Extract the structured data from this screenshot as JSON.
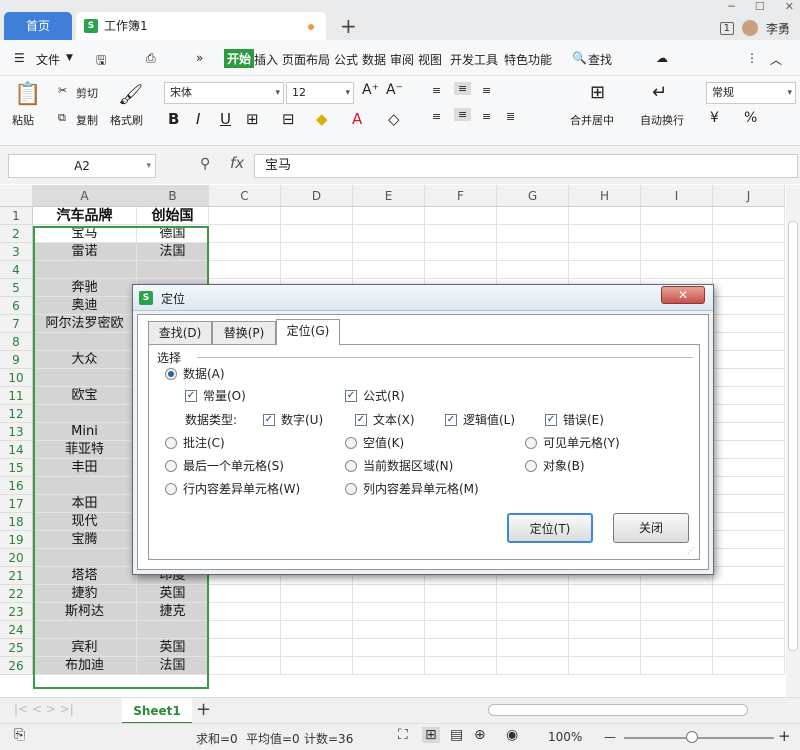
{
  "titlebar": {
    "home_tab": "首页",
    "workbook_tab": "工作簿1",
    "new_tab": "+",
    "badge": "1",
    "user": "李勇",
    "book_icon": "S"
  },
  "menu": {
    "file": "文件",
    "items": [
      "开始",
      "插入",
      "页面布局",
      "公式",
      "数据",
      "审阅",
      "视图",
      "开发工具",
      "特色功能"
    ],
    "search": "查找"
  },
  "ribbon": {
    "paste": "粘贴",
    "cut": "剪切",
    "copy": "复制",
    "format_painter": "格式刷",
    "font": "宋体",
    "size": "12",
    "merge": "合并居中",
    "autowrap": "自动换行",
    "number_format": "常规",
    "percent": "%",
    "bold": "B",
    "italic": "I",
    "underline": "U"
  },
  "formula": {
    "namebox": "A2",
    "fx": "fx",
    "value": "宝马"
  },
  "grid": {
    "columns": [
      "A",
      "B",
      "C",
      "D",
      "E",
      "F",
      "G",
      "H",
      "I",
      "J"
    ],
    "rows": [
      "1",
      "2",
      "3",
      "4",
      "5",
      "6",
      "7",
      "8",
      "9",
      "10",
      "11",
      "12",
      "13",
      "14",
      "15",
      "16",
      "17",
      "18",
      "19",
      "20",
      "21",
      "22",
      "23",
      "24",
      "25",
      "26"
    ],
    "colA": [
      "汽车品牌",
      "宝马",
      "雷诺",
      "",
      "奔驰",
      "奥迪",
      "阿尔法罗密欧",
      "",
      "大众",
      "",
      "欧宝",
      "",
      "Mini",
      "菲亚特",
      "丰田",
      "",
      "本田",
      "现代",
      "宝腾",
      "",
      "塔塔",
      "捷豹",
      "斯柯达",
      "",
      "宾利",
      "布加迪"
    ],
    "colB": [
      "创始国",
      "德国",
      "法国",
      "",
      "",
      "",
      "",
      "",
      "",
      "",
      "",
      "",
      "",
      "",
      "",
      "",
      "",
      "",
      "",
      "",
      "印度",
      "英国",
      "捷克",
      "",
      "英国",
      "法国"
    ]
  },
  "sheet": {
    "tab": "Sheet1",
    "add": "+"
  },
  "status": {
    "sum": "求和=0",
    "avg": "平均值=0",
    "count": "计数=36",
    "zoom": "100%",
    "minus": "—",
    "plus": "+"
  },
  "dialog": {
    "title": "定位",
    "close": "✕",
    "tabs": [
      "查找(D)",
      "替换(P)",
      "定位(G)"
    ],
    "group": "选择",
    "data": "数据(A)",
    "constant": "常量(O)",
    "formula": "公式(R)",
    "data_type": "数据类型:",
    "number": "数字(U)",
    "text": "文本(X)",
    "logical": "逻辑值(L)",
    "error": "错误(E)",
    "comment": "批注(C)",
    "blank": "空值(K)",
    "visible": "可见单元格(Y)",
    "last_cell": "最后一个单元格(S)",
    "current_region": "当前数据区域(N)",
    "object": "对象(B)",
    "row_diff": "行内容差异单元格(W)",
    "col_diff": "列内容差异单元格(M)",
    "goto_button": "定位(T)",
    "close_button": "关闭",
    "check": "✓"
  }
}
